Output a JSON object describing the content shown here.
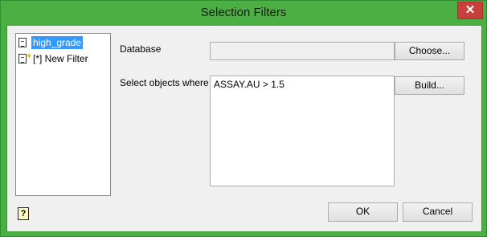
{
  "window": {
    "title": "Selection Filters",
    "close_glyph": "✕"
  },
  "filter_list": {
    "items": [
      {
        "label": "high_grade",
        "icon": "document-icon",
        "selected": true
      },
      {
        "label": "[*] New Filter",
        "icon": "new-document-icon",
        "selected": false
      }
    ]
  },
  "database": {
    "label": "Database",
    "value": "",
    "choose_label": "Choose..."
  },
  "select": {
    "label": "Select objects where",
    "expression": "ASSAY.AU > 1.5",
    "build_label": "Build..."
  },
  "footer": {
    "ok_label": "OK",
    "cancel_label": "Cancel",
    "help_glyph": "?"
  }
}
